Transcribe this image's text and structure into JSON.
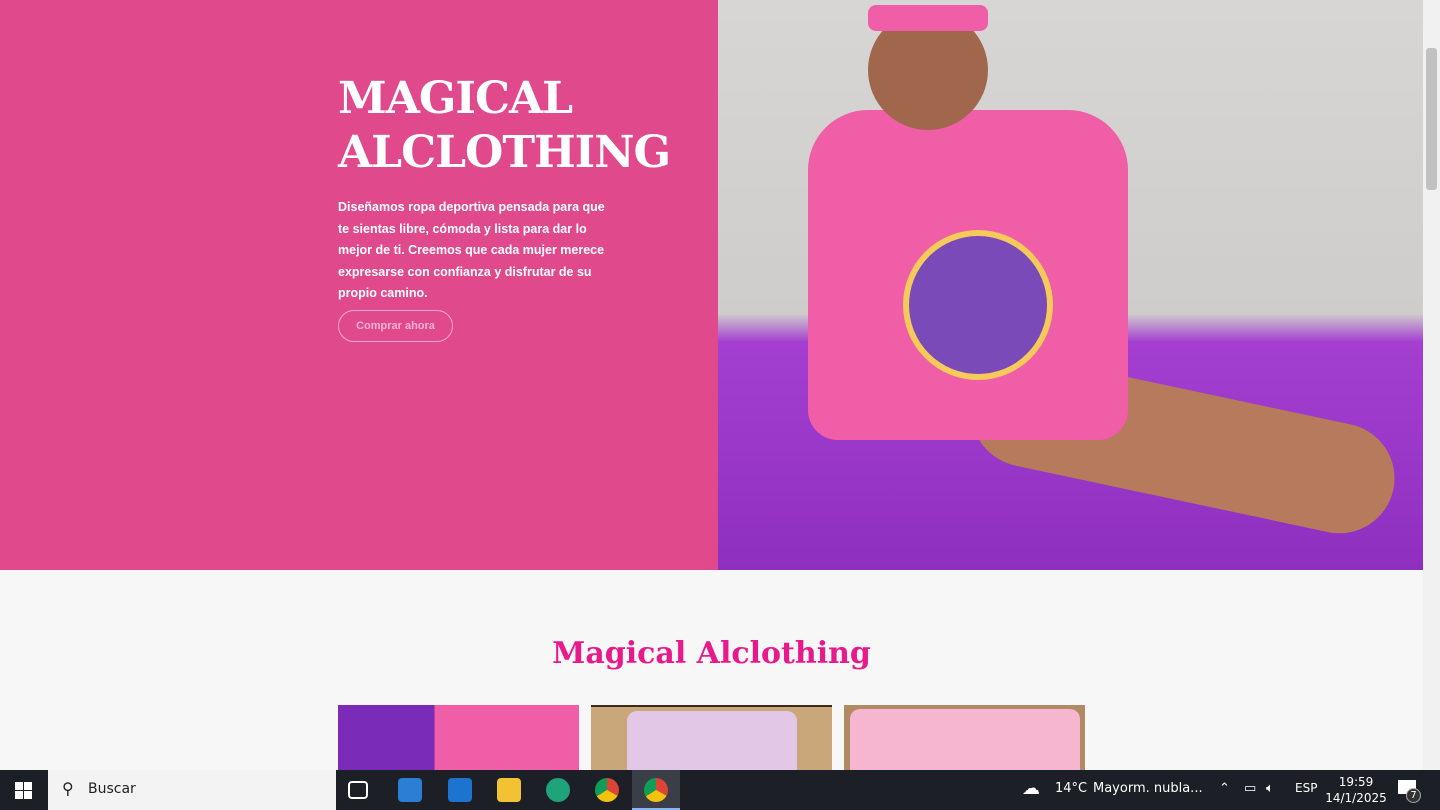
{
  "hero": {
    "title_line1": "MAGICAL",
    "title_line2": "ALCLOTHING",
    "description": "Diseñamos ropa deportiva pensada para que te sientas libre, cómoda y lista para dar lo mejor de ti. Creemos que cada mujer merece expresarse con confianza y disfrutar de su propio camino.",
    "cta": "Comprar ahora"
  },
  "section": {
    "title": "Magical Alclothing"
  },
  "taskbar": {
    "search_placeholder": "Buscar",
    "weather_temp": "14°C",
    "weather_text": "Mayorm. nubla...",
    "language": "ESP",
    "time": "19:59",
    "date": "14/1/2025",
    "notifications": "7"
  },
  "colors": {
    "hero_bg": "#e0498b",
    "accent": "#e8198b"
  }
}
